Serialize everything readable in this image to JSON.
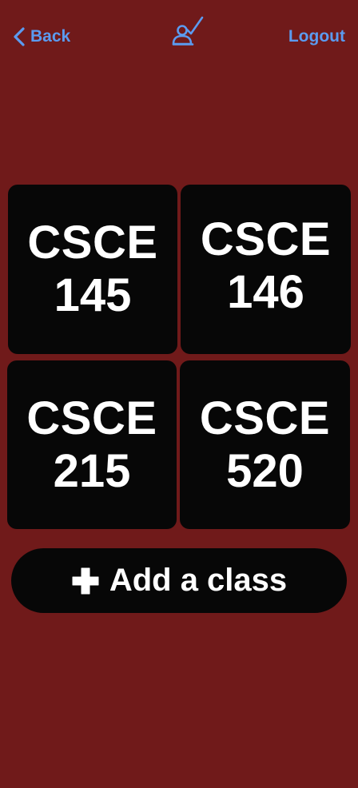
{
  "nav": {
    "back_label": "Back",
    "logout_label": "Logout",
    "logo_icon": "attendance-check-icon",
    "accent_color": "#5b9bf0"
  },
  "classes": [
    {
      "code": "CSCE",
      "number": "145"
    },
    {
      "code": "CSCE",
      "number": "146"
    },
    {
      "code": "CSCE",
      "number": "215"
    },
    {
      "code": "CSCE",
      "number": "520"
    }
  ],
  "add_button": {
    "label": "Add a class",
    "icon": "plus-icon"
  },
  "colors": {
    "background": "#701a1a",
    "tile": "#070707",
    "text": "#ffffff"
  }
}
